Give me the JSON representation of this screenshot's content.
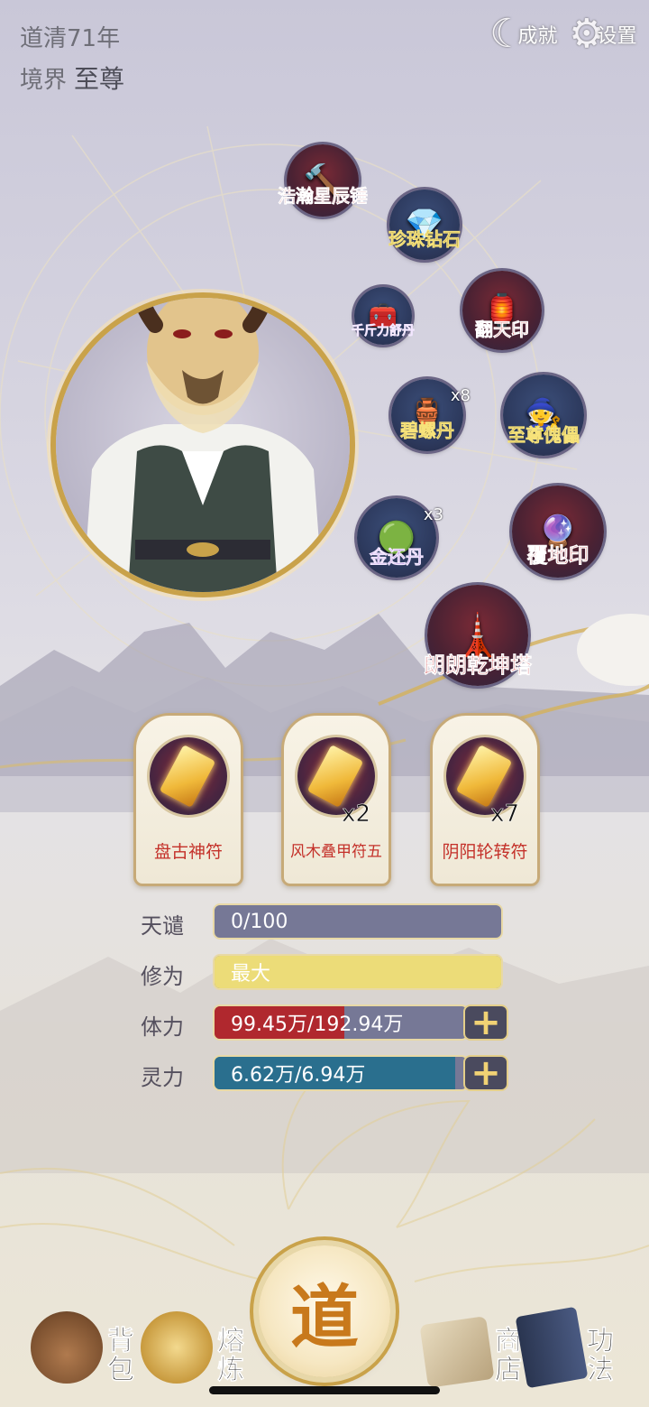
{
  "status": {
    "year": "道清71年",
    "realm_label": "境界",
    "realm_value": "至尊"
  },
  "top_actions": {
    "achievement": "成就",
    "settings": "设置"
  },
  "equipment": [
    {
      "name": "浩瀚星辰锤",
      "icon": "hammer-icon"
    },
    {
      "name": "珍珠钻石",
      "icon": "pearl-diamond-icon"
    },
    {
      "name": "千斤力舒丹",
      "icon": "treasure-chest-icon"
    },
    {
      "name": "翻天印",
      "icon": "seal-icon"
    },
    {
      "name": "碧螺丹",
      "count": "x8",
      "icon": "vase-icon"
    },
    {
      "name": "至尊傀儡",
      "icon": "puppet-icon"
    },
    {
      "name": "金还丹",
      "count": "x3",
      "icon": "chest-orb-icon"
    },
    {
      "name": "覆地印",
      "icon": "orb-seal-icon"
    },
    {
      "name": "朗朗乾坤塔",
      "icon": "pagoda-icon"
    }
  ],
  "talismans": [
    {
      "name": "盘古神符",
      "count": ""
    },
    {
      "name": "风木叠甲符五",
      "count": "x2"
    },
    {
      "name": "阴阳轮转符",
      "count": "x7"
    }
  ],
  "stats": {
    "tianqian": {
      "label": "天谴",
      "value": "0/100",
      "fraction": 0.0
    },
    "xiuwei": {
      "label": "修为",
      "value": "最大",
      "fraction": 1.0
    },
    "tili": {
      "label": "体力",
      "value": "99.45万/192.94万",
      "fraction": 0.515
    },
    "lingli": {
      "label": "灵力",
      "value": "6.62万/6.94万",
      "fraction": 0.954
    }
  },
  "nav": {
    "bag": "背包",
    "forge": "熔炼",
    "dao": "道",
    "shop": "商店",
    "technique": "功法"
  },
  "colors": {
    "hp": "#b0282e",
    "mp": "#2a6f8e",
    "cultivation": "#ecdc78",
    "bar_track": "#767896",
    "label_red": "#c4312a"
  }
}
